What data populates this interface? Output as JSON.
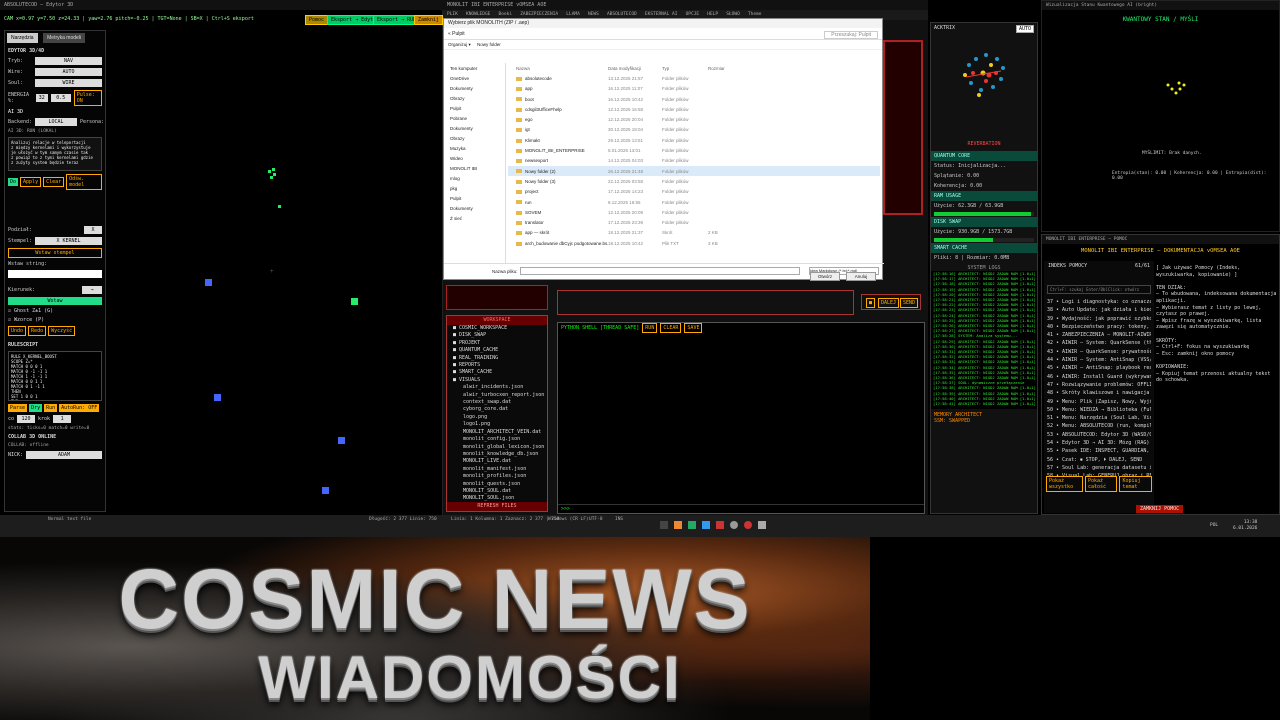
{
  "editor": {
    "window_title": "ABSOLUTECOD — Edytor 3D",
    "hud": "CAM x=0.97 y=7.50 z=24.33 | yaw=2.76 pitch=-0.25 | TGT=None | SB=X | Ctrl+S eksport",
    "top_buttons": [
      "Pomoc",
      "Eksport → Edytor",
      "Eksport → RUN",
      "Zamknij"
    ],
    "tabs": [
      "Narzędzia",
      "Metryka modeli"
    ],
    "panel_title": "EDYTOR 3D/4D",
    "fields": [
      {
        "label": "Tryb:",
        "value": "NAV"
      },
      {
        "label": "Wire:",
        "value": "AUTO"
      },
      {
        "label": "Soul:",
        "value": "WIRE"
      }
    ],
    "energia_label": "ENERGIA %:",
    "energia_value": "32",
    "energia_value2": "0.5",
    "pulse": "Pulse: ON",
    "ai_label": "AI 3D",
    "backend_label": "Backend:",
    "backend_value": "LOCAL",
    "persona_label": "Persona:",
    "ai_status": "AI 3D: RUN (LOKAL)",
    "code_text": "Analizuj relacje w teleportacji\nz między kernelami i wykorzystuje\nje ułożyć w tym samym czasie tak\nz powiąż to z tymi kernelami gdzie\nz zużyty system będzie teraz",
    "ai_buttons": [
      "Do",
      "Apply",
      "Clear",
      "Odśw. model"
    ],
    "podzial_label": "Podział:",
    "podzial_value": "X",
    "stempel_label": "Stempel:",
    "stempel_value": "X KERNEL",
    "wstaw_stempel": "Wstaw stempel",
    "wstaw_string_label": "Wstaw string:",
    "kierunek_label": "Kierunek:",
    "kierunek_value": "→",
    "wstaw_button": "Wstaw",
    "ghost_label": "Ghost Z±1 (G)",
    "wzorce_label": "Wzorce (P)",
    "edit_buttons": [
      "Undo",
      "Redo",
      "Wyczyść"
    ],
    "rulescript_title": "RULESCRIPT",
    "rulescript": "RULE X_KERNEL_BOOST\nSCOPE Z=*\nMATCH 0 0 0 1\nMATCH 0 -1 -1 1\nMATCH 1 -1 -1 1\nMATCH 0 0 1 1\nMATCH 0 1 -1 1\nTHEN\nSET 1 0 0 1\nTHR",
    "rule_buttons": [
      "Parse",
      "Dry",
      "Run",
      "AutoRun: OFF"
    ],
    "step_label": "co",
    "step_value": "120",
    "krok_label": "krok",
    "krok_value": "1",
    "stats": "stats: ticks=0 match=0 write=0",
    "collab_title": "COLLAB 3D ONLINE",
    "collab_status": "COLLAB: offline",
    "nick_label": "NICK:",
    "nick_value": "ADAM"
  },
  "center": {
    "window_title": "MONOLIT IBI ENTERPRISE vOMSEA AOE",
    "menu": [
      "PLIK",
      "KNOWLEDGE",
      "Booki",
      "ZABEZPIECZENIA",
      "LLAMA",
      "NEWS",
      "ABSOLUTECOD",
      "EKSTERNAL AI",
      "OPCJE",
      "HELP",
      "SŁOWO",
      "Theme"
    ],
    "dialog": {
      "title": "Wybierz plik MONOLITH (ZIP / .aep)",
      "path": "« Pulpit",
      "search_placeholder": "Przeszukaj: Pulpit",
      "toolbar": [
        "Organizuj ▾",
        "Nowy folder"
      ],
      "nav": [
        "Ten komputer",
        "OneDrive",
        "Dokumenty",
        "Obrazy",
        "Pulpit",
        "Pobrane",
        "Dokumenty",
        "Obrazy",
        "Muzyka",
        "Wideo",
        "MONOLIT IBI",
        "mlog",
        "pkg",
        "Pulpit",
        "Dokumenty",
        "Ż sieć"
      ],
      "columns": [
        "Nazwa",
        "Data modyfikacji",
        "Typ",
        "Rozmiar"
      ],
      "rows": [
        [
          "absolutecode",
          "13.12.2025 21:57",
          "Folder plików",
          ""
        ],
        [
          "app",
          "16.12.2025 11:07",
          "Folder plików",
          ""
        ],
        [
          "boot",
          "16.12.2025 10:42",
          "Folder plików",
          ""
        ],
        [
          "cdsgil3UfficeFhelp",
          "12.12.2025 16:58",
          "Folder plików",
          ""
        ],
        [
          "ego",
          "12.12.2025 20:04",
          "Folder plików",
          ""
        ],
        [
          "igt",
          "30.12.2025 18:04",
          "Folder plików",
          ""
        ],
        [
          "Klimakt",
          "29.12.2025 13:51",
          "Folder plików",
          ""
        ],
        [
          "MONOLIT_IBI_ENTERPRISE",
          "5.01.2026 13:01",
          "Folder plików",
          ""
        ],
        [
          "newsexport",
          "14.12.2025 04:03",
          "Folder plików",
          ""
        ],
        [
          "Nowy folder (2)",
          "26.12.2025 21:48",
          "Folder plików",
          ""
        ],
        [
          "Nowy folder (3)",
          "22.12.2025 03:58",
          "Folder plików",
          ""
        ],
        [
          "project",
          "17.12.2025 14:23",
          "Folder plików",
          ""
        ],
        [
          "run",
          "8.12.2025 16:55",
          "Folder plików",
          ""
        ],
        [
          "SOVEM",
          "12.12.2025 20:09",
          "Folder plików",
          ""
        ],
        [
          "translator",
          "17.12.2025 23:39",
          "Folder plików",
          ""
        ],
        [
          "app — skrót",
          "18.12.2025 21:37",
          "Skrót",
          "2 KB"
        ],
        [
          "arch_budowanie dbCyjc podgotowane.bs...",
          "18.12.2025 10:42",
          "Plik TXT",
          "3 KB"
        ]
      ],
      "filename_label": "Nazwa pliku:",
      "filetype": "Idea Markdown (*.txt;*.md)",
      "ok_button": "Otwórz",
      "cancel_button": "Anuluj"
    },
    "workspace_title": "WORKSPACE",
    "workspace_items": [
      "COSMIC_WORKSPACE",
      "DISK_SWAP",
      "PROJEKT",
      "QUANTUM_CACHE",
      "REAL_TRAINING",
      "REPORTS",
      "SMART_CACHE",
      "VISUALS",
      "alwir_incidents.json",
      "alwir_turbocxen_report.json",
      "context_swap.dat",
      "cyborg_core.dat",
      "logo.png",
      "logo1.png",
      "MONOLIT_ARCHITECT_VEIN.dat",
      "monolit_config.json",
      "monolit_global_lexicon.json",
      "monolit_knowledge_db.json",
      "MONOLIT_LIVE.dat",
      "monolit_manifest.json",
      "monolit_profiles.json",
      "monolit_quests.json",
      "MONOLIT_SOUL.dat",
      "MONOLIT_SOUL.json"
    ],
    "refresh_button": "REFRESH FILES",
    "shell_title": "PYTHON SHELL [THREAD SAFE]",
    "shell_buttons": [
      "RUN",
      "CLEAR",
      "SAVE"
    ],
    "shell_prompt": ">>>",
    "dalej_button": "DALEJ",
    "send_button": "SEND",
    "statusbar": [
      "Normal text file",
      "Długość: 2 377  Linie: 750",
      "Linia: 1  Kolumna: 1  Zaznacz: 2 377 | 750",
      "Windows (CR LF)",
      "UTF-8",
      "INS"
    ]
  },
  "right": {
    "acktrix": "ACKTRIX",
    "auto": "AUTO",
    "reverb": "REVERBATION",
    "quantum_core": "QUANTUM CORE",
    "status": "Status: Inicjalizacja...",
    "splatanie": "Splątanie: 0.00",
    "koherencja": "Koherencja: 0.00",
    "ram_usage": "RAM USAGE",
    "ram_value": "Użycie: 62.3GB / 63.9GB",
    "ram_pct": 0.97,
    "disk_swap": "DISK SWAP",
    "disk_value": "Użycie: 930.9GB / 1573.7GB",
    "disk_pct": 0.59,
    "smart_cache": "SMART CACHE",
    "cache_value": "Pliki: 8 | Rozmiar: 0.0MB",
    "system_logs": "SYSTEM LOGS",
    "log_lines": [
      "[17:58:16] ARCHITECT: NIGDJ ZADAN RAM [1.0+1]",
      "[17:58:17] ARCHITECT: NIGDJ ZADAN RAM [1.0+1]",
      "[17:58:18] ARCHITECT: NIGDJ ZADAN RAM [1.0+1]",
      "[17:58:19] ARCHITECT: NIGDJ ZADAN RAM [1.0+1]",
      "[17:58:20] ARCHITECT: NIGDJ ZADAN RAM [1.0+1]",
      "[17:58:21] ARCHITECT: NIGDJ ZADAN RAM [1.0+1]",
      "[17:58:22] ARCHITECT: NIGDJ ZADAN RAM [1.0+1]",
      "[17:58:23] ARCHITECT: NIGDJ ZADAN RAM [1.0+1]",
      "[17:58:24] ARCHITECT: NIGDJ ZADAN RAM [1.0+1]",
      "[17:58:25] ARCHITECT: NIGDJ ZADAN RAM [1.0+1]",
      "[17:58:26] ARCHITECT: NIGDJ ZADAN RAM [1.0+1]",
      "[17:58:27] ARCHITECT: NIGDJ ZADAN RAM [1.0+1]",
      "[17:58:28] SYSTEM: Analiza systemu...",
      "[17:58:29] ARCHITECT: NIGDJ ZADAN RAM [1.0+1]",
      "[17:58:30] ARCHITECT: NIGDJ ZADAN RAM [1.0+1]",
      "[17:58:31] ARCHITECT: NIGDJ ZADAN RAM [1.0+1]",
      "[17:58:32] ARCHITECT: NIGDJ ZADAN RAM [1.0+1]",
      "[17:58:33] ARCHITECT: NIGDJ ZADAN RAM [1.0+1]",
      "[17:58:34] ARCHITECT: NIGDJ ZADAN RAM [1.0+1]",
      "[17:58:35] ARCHITECT: NIGDJ ZADAN RAM [1.0+1]",
      "[17:58:36] ARCHITECT: NIGDJ ZADAN RAM [1.0+1]",
      "[17:58:37] SOUL: dynamiczne przełączenie",
      "[17:58:38] ARCHITECT: NIGDJ ZADAN RAM [1.0+1]",
      "[17:58:39] ARCHITECT: NIGDJ ZADAN RAM [1.0+1]",
      "[17:58:40] ARCHITECT: NIGDJ ZADAN RAM [1.0+1]",
      "[17:58:41] ARCHITECT: NIGDJ ZADAN RAM [1.0+1]"
    ],
    "memory_title": "MEMORY ARCHITECT",
    "memory_status": "SSM: SWAPPED"
  },
  "quantum": {
    "window_title": "Wizualizacja Stanu Kwantowego AI (bright)",
    "title": "KWANTOWY STAN / MYŚLI",
    "mysl": "MYŚLIMIT: Brak danych.",
    "metrics": "Entropia(stan): 0.00 | Koherencja: 0.00 | Entropia(dist): 0.00"
  },
  "docs": {
    "window_title": "MONOLIT IBI ENTERPRISE — POMOC",
    "title": "MONOLIT IBI ENTERPRISE — DOKUMENTACJA vOMSEA AOE",
    "index_title": "INDEKS POMOCY",
    "index_count": "61/61",
    "search_hint": "Ctrl+F: szukaj   Enter/DblClick: otwórz",
    "items": [
      "37 • Logi i diagnostyka: co oznaczają komunikaty",
      "38 • Auto Update: jak działa i kiedy używać",
      "39 • Wydajność: jak poprawić szybkość i stabilność",
      "40 • Bezpieczeństwo pracy: tokeny, klucze, prywatność",
      "41 • ZABEZPIECZENIA — MONOLIT-AIWIR",
      "42 • AIWIR — System: QuarkSense (thr, hold)",
      "43 • AIWIR — QuarkSense: prywatność (lokalne)",
      "44 • AIWIR — System: AntiSnap (VSS/Shadow)",
      "45 • AIWIR — AntiSnap: playbook reakcji i tryby",
      "46 • AIWIR: Install Guard (wykrywanie podejrzanych)",
      "47 • Rozwiązywanie problemów: OFFLINE, nic nie działa",
      "48 • Skróty klawiszowe i nawigacja",
      "49 • Menu: Plik (Zapisz, Nowy, Wyjście)",
      "50 • Menu: WIEDZA → Biblioteka (Full & Vis)",
      "51 • Menu: Narzędzia (Soul Lab, Visual Lab)",
      "52 • Menu: ABSOLUTECOD (run, kompilacja)",
      "53 • ABSOLUTECOD: Edytor 3D (WASD/QE)",
      "54 • Edytor 3D → AI 3D: Mózg (RAG) — jak działa",
      "55 • Pasek IDE: INSPECT, GUARDIAN, PURGE",
      "56 • Czat: ⏹ STOP, ⏵ DALEJ, SEND",
      "57 • Soul Lab: generacja datasetu i eksport",
      "58 • Visual Lab: GENERUJ obraz i RENDERUJ",
      "59 • ABSOLUTECOD Analyzer Analizuj. Interpret"
    ],
    "help_text": "[ Jak używać Pomocy (Indeks, wyszukiwarka, kopiowanie) ]\n\nTEN DZIAŁ:\n– To wbudowana, indeksowana dokumentacja aplikacji.\n– Wybierasz temat z listy po lewej, czytasz po prawej.\n– Wpisz frazę w wyszukiwarkę, lista zawęzi się automatycznie.\n\nSKRÓTY:\n– Ctrl+F: fokus na wyszukiwarkę\n– Esc: zamknij okno pomocy\n\nKOPIOWANIE:\n– Kopiuj temat przenosi aktualny tekst do schowka.",
    "buttons": [
      "Pokaż wszystko",
      "Pokaż całość",
      "Kopiuj temat"
    ],
    "close_button": "ZAMKNIJ POMOC"
  },
  "taskbar": {
    "time": "13:38",
    "date": "6.01.2026",
    "lang": "POL"
  },
  "banner": {
    "title": "COSMIC NEWS",
    "subtitle": "WIADOMOŚCI"
  }
}
